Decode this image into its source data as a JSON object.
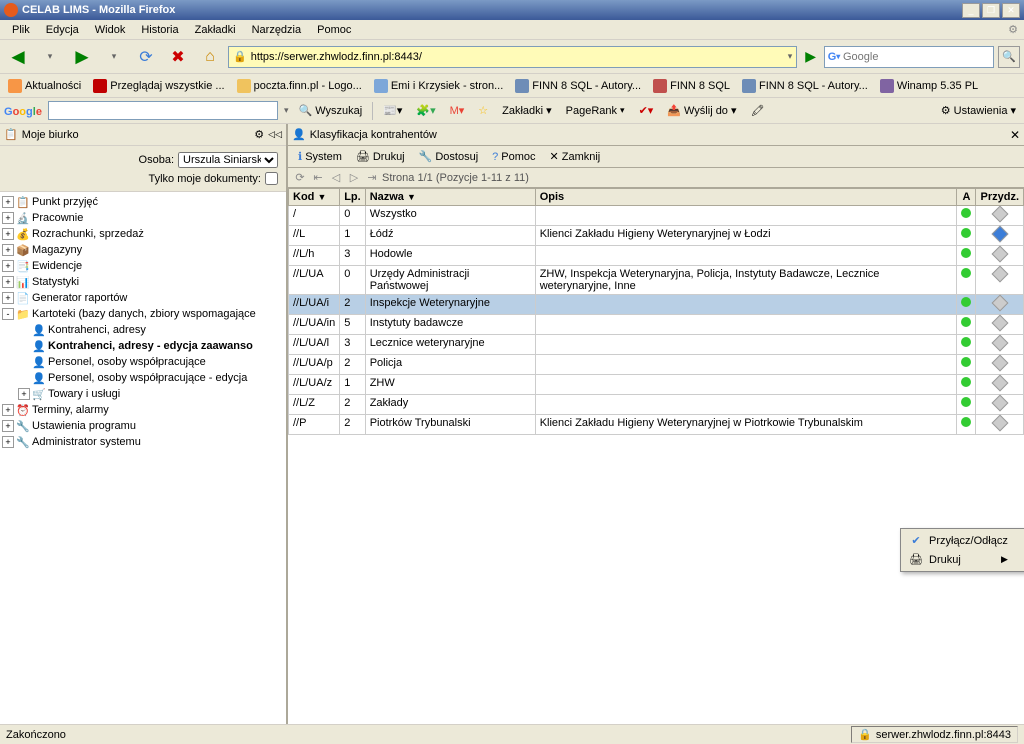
{
  "title": "CELAB LIMS - Mozilla Firefox",
  "menubar": [
    "Plik",
    "Edycja",
    "Widok",
    "Historia",
    "Zakładki",
    "Narzędzia",
    "Pomoc"
  ],
  "url": "https://serwer.zhwlodz.finn.pl:8443/",
  "search_engine": "Google",
  "bookmarks": [
    {
      "label": "Aktualności",
      "color": "#f79646"
    },
    {
      "label": "Przeglądaj wszystkie ...",
      "color": "#c00000"
    },
    {
      "label": "poczta.finn.pl - Logo...",
      "color": "#f0c35e"
    },
    {
      "label": "Emi i Krzysiek - stron...",
      "color": "#7da7d9"
    },
    {
      "label": "FINN 8 SQL - Autory...",
      "color": "#6e8db7"
    },
    {
      "label": "FINN 8 SQL",
      "color": "#c0504d"
    },
    {
      "label": "FINN 8 SQL - Autory...",
      "color": "#6e8db7"
    },
    {
      "label": "Winamp 5.35 PL",
      "color": "#8064a2"
    }
  ],
  "googlebar": {
    "search_label": "Wyszukaj",
    "bookmarks_label": "Zakładki",
    "pagerank_label": "PageRank",
    "send_label": "Wyślij do",
    "settings_label": "Ustawienia"
  },
  "sidebar": {
    "title": "Moje biurko",
    "osoba_label": "Osoba:",
    "osoba_value": "Urszula Siniarska",
    "only_my_docs": "Tylko moje dokumenty:",
    "tree": [
      {
        "label": "Punkt przyjęć",
        "exp": "+",
        "icon": "📋",
        "indent": 0
      },
      {
        "label": "Pracownie",
        "exp": "+",
        "icon": "🔬",
        "indent": 0
      },
      {
        "label": "Rozrachunki, sprzedaż",
        "exp": "+",
        "icon": "💰",
        "indent": 0
      },
      {
        "label": "Magazyny",
        "exp": "+",
        "icon": "📦",
        "indent": 0
      },
      {
        "label": "Ewidencje",
        "exp": "+",
        "icon": "📑",
        "indent": 0
      },
      {
        "label": "Statystyki",
        "exp": "+",
        "icon": "📊",
        "indent": 0
      },
      {
        "label": "Generator raportów",
        "exp": "+",
        "icon": "📄",
        "indent": 0
      },
      {
        "label": "Kartoteki (bazy danych, zbiory wspomagające",
        "exp": "-",
        "icon": "📁",
        "indent": 0
      },
      {
        "label": "Kontrahenci, adresy",
        "exp": "",
        "icon": "👤",
        "indent": 1
      },
      {
        "label": "Kontrahenci, adresy - edycja zaawanso",
        "exp": "",
        "icon": "👤",
        "indent": 1,
        "bold": true
      },
      {
        "label": "Personel, osoby współpracujące",
        "exp": "",
        "icon": "👤",
        "indent": 1
      },
      {
        "label": "Personel, osoby współpracujące - edycja",
        "exp": "",
        "icon": "👤",
        "indent": 1
      },
      {
        "label": "Towary i usługi",
        "exp": "+",
        "icon": "🛒",
        "indent": 1
      },
      {
        "label": "Terminy, alarmy",
        "exp": "+",
        "icon": "⏰",
        "indent": 0
      },
      {
        "label": "Ustawienia programu",
        "exp": "+",
        "icon": "🔧",
        "indent": 0
      },
      {
        "label": "Administrator systemu",
        "exp": "+",
        "icon": "🔧",
        "indent": 0
      }
    ]
  },
  "content": {
    "title": "Klasyfikacja kontrahentów",
    "toolbar": {
      "system": "System",
      "print": "Drukuj",
      "adjust": "Dostosuj",
      "help": "Pomoc",
      "close": "Zamknij"
    },
    "pager": "Strona 1/1 (Pozycje 1-11 z 11)",
    "columns": [
      "Kod",
      "Lp.",
      "Nazwa",
      "Opis",
      "A",
      "Przydz."
    ],
    "rows": [
      {
        "kod": "/",
        "lp": "0",
        "nazwa": "Wszystko",
        "opis": "",
        "blue": false
      },
      {
        "kod": "//L",
        "lp": "1",
        "nazwa": "Łódź",
        "opis": "Klienci Zakładu Higieny Weterynaryjnej w Łodzi",
        "blue": true
      },
      {
        "kod": "//L/h",
        "lp": "3",
        "nazwa": "Hodowle",
        "opis": "",
        "blue": false
      },
      {
        "kod": "//L/UA",
        "lp": "0",
        "nazwa": "Urzędy Administracji Państwowej",
        "opis": "ZHW, Inspekcja Weterynaryjna, Policja, Instytuty Badawcze, Lecznice weterynaryjne, Inne",
        "blue": false
      },
      {
        "kod": "//L/UA/i",
        "lp": "2",
        "nazwa": "Inspekcje Weterynaryjne",
        "opis": "",
        "blue": false,
        "selected": true
      },
      {
        "kod": "//L/UA/in",
        "lp": "5",
        "nazwa": "Instytuty badawcze",
        "opis": "",
        "blue": false
      },
      {
        "kod": "//L/UA/l",
        "lp": "3",
        "nazwa": "Lecznice weterynaryjne",
        "opis": "",
        "blue": false
      },
      {
        "kod": "//L/UA/p",
        "lp": "2",
        "nazwa": "Policja",
        "opis": "",
        "blue": false
      },
      {
        "kod": "//L/UA/z",
        "lp": "1",
        "nazwa": "ZHW",
        "opis": "",
        "blue": false
      },
      {
        "kod": "//L/Z",
        "lp": "2",
        "nazwa": "Zakłady",
        "opis": "",
        "blue": false
      },
      {
        "kod": "//P",
        "lp": "2",
        "nazwa": "Piotrków Trybunalski",
        "opis": "Klienci Zakładu Higieny Weterynaryjnej w Piotrkowie Trybunalskim",
        "blue": false
      }
    ]
  },
  "context_menu": {
    "attach": "Przyłącz/Odłącz",
    "print": "Drukuj"
  },
  "statusbar": {
    "left": "Zakończono",
    "right": "serwer.zhwlodz.finn.pl:8443"
  }
}
